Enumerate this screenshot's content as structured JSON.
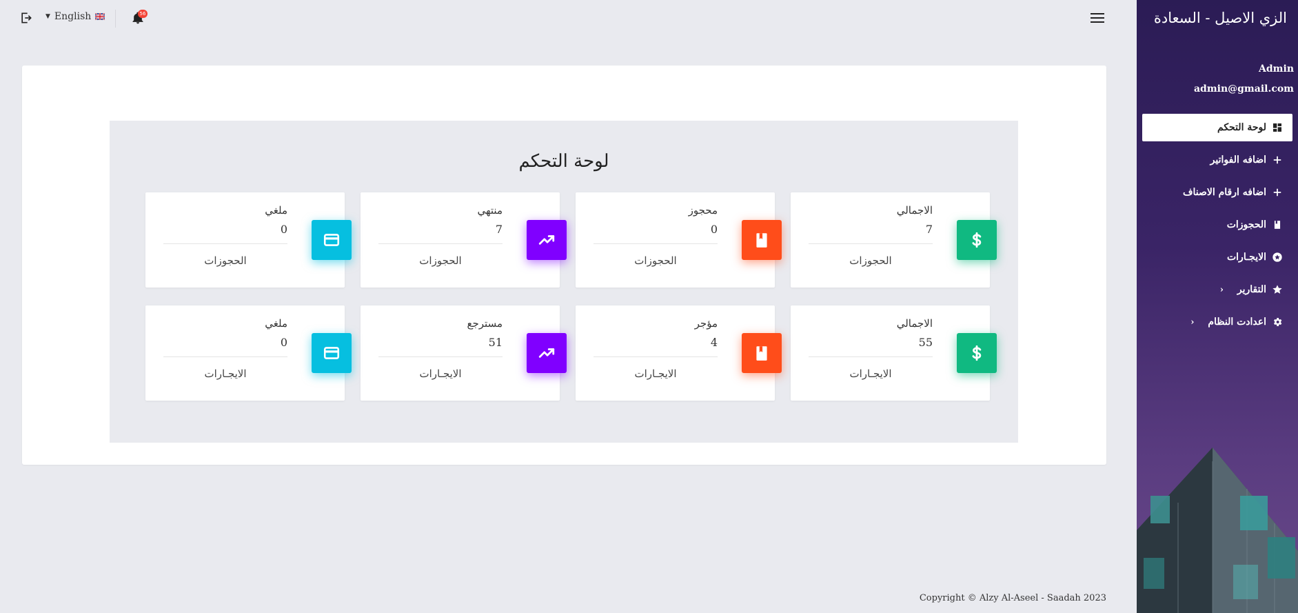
{
  "sidebar": {
    "brand": "الزي الاصيل - السعادة",
    "user_name": "Admin",
    "user_email": "admin@gmail.com",
    "items": [
      {
        "label": "لوحة التحكم",
        "icon": "dashboard-icon",
        "active": true
      },
      {
        "label": "اضافه الفواتير",
        "icon": "plus-icon"
      },
      {
        "label": "اضافه ارقام الاصناف",
        "icon": "plus-icon"
      },
      {
        "label": "الحجوزات",
        "icon": "bookmark-icon"
      },
      {
        "label": "الايجـارات",
        "icon": "star-circle-icon"
      },
      {
        "label": "التقارير",
        "icon": "star-icon",
        "caret": "‹"
      },
      {
        "label": "اعدادت النظام",
        "icon": "gear-icon",
        "caret": "‹"
      }
    ]
  },
  "topbar": {
    "language": "English",
    "notification_count": "56"
  },
  "dashboard": {
    "title": "لوحة التحكم",
    "rows": [
      [
        {
          "label": "الاجمالي",
          "value": "7",
          "footer": "الحجوزات",
          "icon": "dollar-icon",
          "color": "#10b981"
        },
        {
          "label": "محجوز",
          "value": "0",
          "footer": "الحجوزات",
          "icon": "bookmark-icon",
          "color": "#ff4d1a"
        },
        {
          "label": "منتهي",
          "value": "7",
          "footer": "الحجوزات",
          "icon": "trending-up-icon",
          "color": "#8000ff"
        },
        {
          "label": "ملغي",
          "value": "0",
          "footer": "الحجوزات",
          "icon": "credit-card-icon",
          "color": "#06bfe0"
        }
      ],
      [
        {
          "label": "الاجمالي",
          "value": "55",
          "footer": "الايجـارات",
          "icon": "dollar-icon",
          "color": "#10b981"
        },
        {
          "label": "مؤجر",
          "value": "4",
          "footer": "الايجـارات",
          "icon": "bookmark-icon",
          "color": "#ff4d1a"
        },
        {
          "label": "مسترجع",
          "value": "51",
          "footer": "الايجـارات",
          "icon": "trending-up-icon",
          "color": "#8000ff"
        },
        {
          "label": "ملغي",
          "value": "0",
          "footer": "الايجـارات",
          "icon": "credit-card-icon",
          "color": "#06bfe0"
        }
      ]
    ]
  },
  "footer": {
    "copyright": "Copyright © Alzy Al-Aseel - Saadah 2023"
  }
}
